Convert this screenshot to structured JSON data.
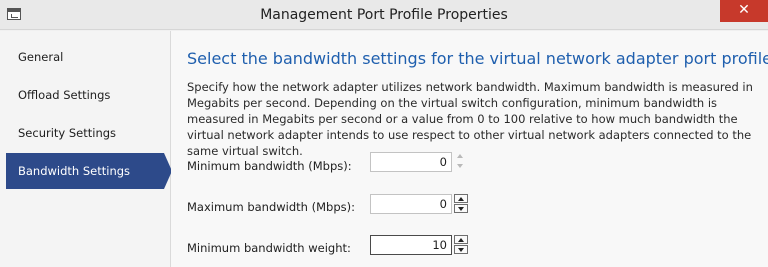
{
  "window": {
    "title": "Management Port Profile Properties",
    "close_label": "✕"
  },
  "sidebar": {
    "items": [
      {
        "label": "General"
      },
      {
        "label": "Offload Settings"
      },
      {
        "label": "Security Settings"
      },
      {
        "label": "Bandwidth Settings",
        "selected": true
      }
    ]
  },
  "main": {
    "heading": "Select the bandwidth settings for the virtual network adapter port profile",
    "description": "Specify how the network adapter utilizes network bandwidth. Maximum bandwidth is measured in Megabits per second. Depending on the virtual switch configuration, minimum bandwidth is measured in Megabits per second or a value from 0 to 100 relative to how much bandwidth the virtual network adapter intends to use respect to other virtual network adapters connected to the same virtual switch.",
    "fields": [
      {
        "label": "Minimum bandwidth (Mbps):",
        "value": "0"
      },
      {
        "label": "Maximum bandwidth (Mbps):",
        "value": "0"
      },
      {
        "label": "Minimum bandwidth weight:",
        "value": "10"
      }
    ]
  },
  "colors": {
    "accent": "#2d4a8a",
    "heading": "#1f5fae",
    "close": "#c7392b"
  }
}
